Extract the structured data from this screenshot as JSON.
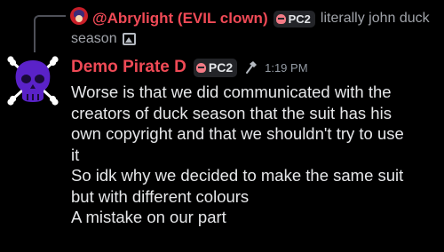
{
  "reply": {
    "author": "@Abrylight (EVIL clown)",
    "tag": "PC2",
    "text_line1": "literally john duck",
    "text_line2": "season"
  },
  "message": {
    "author": "Demo Pirate D",
    "tag": "PC2",
    "timestamp": "1:19 PM",
    "lines": [
      "Worse is that we did communicated with the",
      "creators of duck season that the suit has his",
      "own copyright and that we shouldn't try to use",
      "it",
      "So idk why we decided to make the same suit",
      "but with different colours",
      "A mistake on our part"
    ]
  },
  "colors": {
    "background": "#000000",
    "author": "#f04a56",
    "text": "#e6e7e9",
    "muted": "#a0a3a9",
    "tag_bg": "#232428",
    "avatar_purple": "#5a22c8"
  },
  "icons": [
    "reply-avatar",
    "skull-icon",
    "image-icon",
    "jolly-roger-avatar",
    "hammer-icon"
  ]
}
